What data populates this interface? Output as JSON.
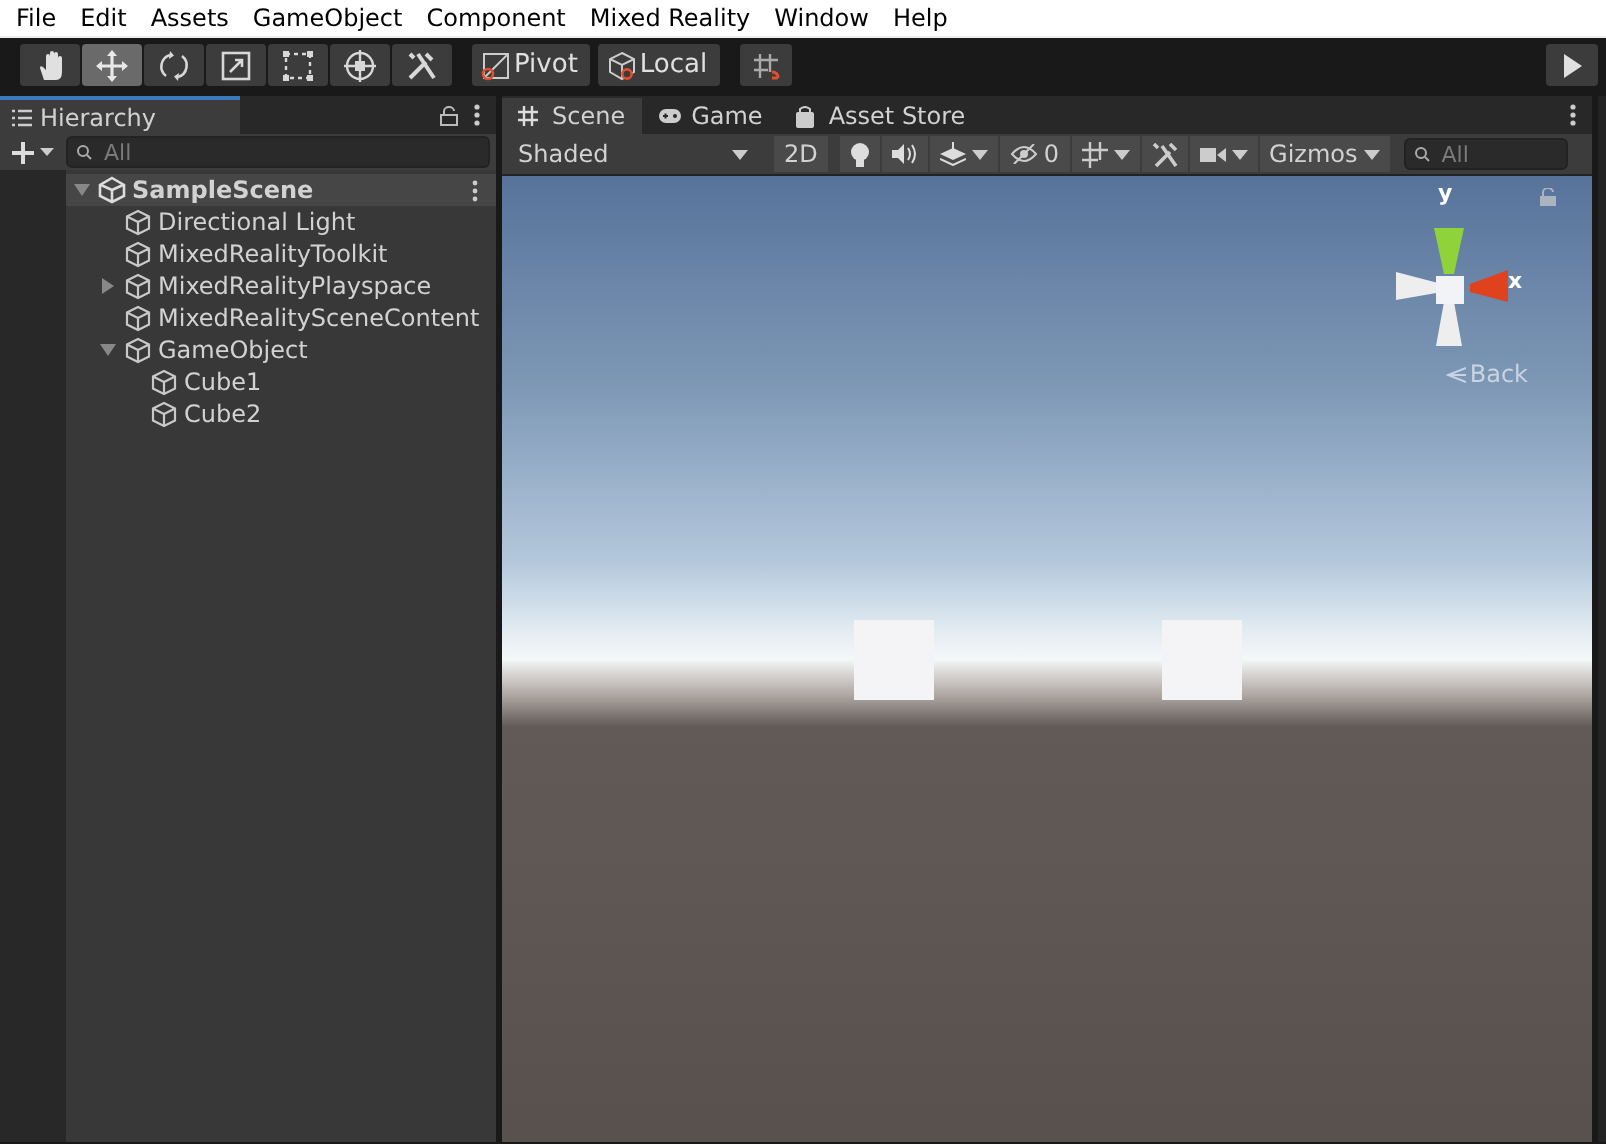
{
  "menu": [
    "File",
    "Edit",
    "Assets",
    "GameObject",
    "Component",
    "Mixed Reality",
    "Window",
    "Help"
  ],
  "tools": [
    {
      "kind": "hand",
      "selected": false
    },
    {
      "kind": "move",
      "selected": true
    },
    {
      "kind": "rotate",
      "selected": false
    },
    {
      "kind": "scale",
      "selected": false
    },
    {
      "kind": "rect",
      "selected": false
    },
    {
      "kind": "transform",
      "selected": false
    },
    {
      "kind": "custom",
      "selected": false
    }
  ],
  "handle_buttons": [
    {
      "kind": "pivot",
      "label": "Pivot"
    },
    {
      "kind": "local",
      "label": "Local"
    }
  ],
  "hierarchy": {
    "title": "Hierarchy",
    "search": {
      "placeholder": "All"
    },
    "tree": [
      {
        "kind": "scene",
        "name": "SampleScene",
        "expanded": true,
        "children": [
          {
            "name": "Directional Light"
          },
          {
            "name": "MixedRealityToolkit"
          },
          {
            "name": "MixedRealityPlayspace",
            "expanded": false
          },
          {
            "name": "MixedRealitySceneContent"
          },
          {
            "name": "GameObject",
            "expanded": true,
            "children": [
              {
                "name": "Cube1"
              },
              {
                "name": "Cube2"
              }
            ]
          }
        ]
      }
    ]
  },
  "scene_tabs": [
    {
      "kind": "scene",
      "label": "Scene",
      "selected": true
    },
    {
      "kind": "game",
      "label": "Game",
      "selected": false
    },
    {
      "kind": "store",
      "label": "Asset Store",
      "selected": false
    }
  ],
  "scene_toolbar": {
    "shading": "Shaded",
    "mode_2d": "2D",
    "hidden_count": "0",
    "gizmos": "Gizmos",
    "search": {
      "placeholder": "All"
    }
  },
  "gizmo": {
    "y_label": "y",
    "x_label": "x",
    "back": "Back"
  }
}
